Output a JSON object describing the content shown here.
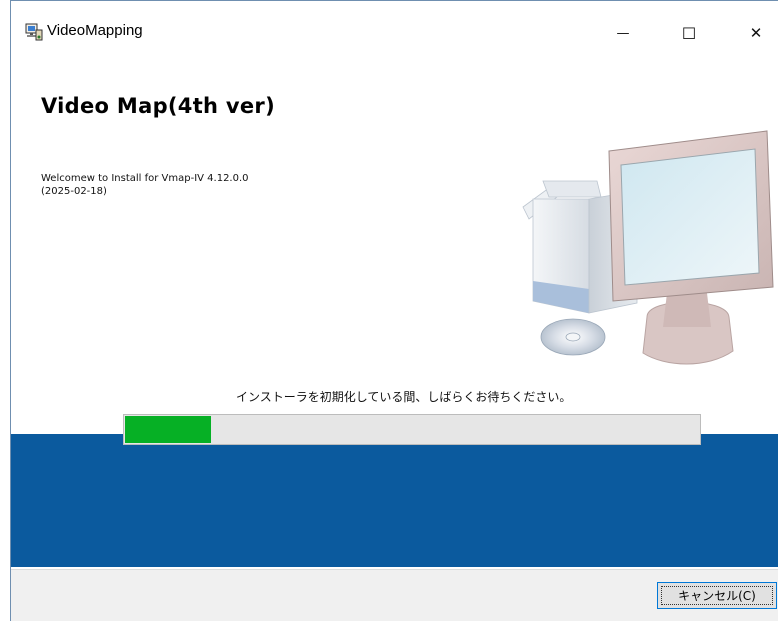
{
  "window": {
    "title": "VideoMapping",
    "minimize_glyph": "—",
    "maximize_glyph": "☐",
    "close_glyph": "✕"
  },
  "content": {
    "heading": "Video Map(4th ver)",
    "welcome_line1": "Welcomew to Install for Vmap-IV 4.12.0.0",
    "welcome_line2": "(2025-02-18)",
    "status_text": "インストーラを初期化している間、しばらくお待ちください。"
  },
  "progress": {
    "value": 15,
    "fill_color": "#06b025"
  },
  "footer": {
    "cancel_label": "キャンセル(C)"
  },
  "icons": {
    "app": "installer-computer-icon",
    "hero": "computer-monitor-box-cd-illustration"
  },
  "colors": {
    "band": "#0b5a9e",
    "footer_bg": "#f0f0f0"
  }
}
